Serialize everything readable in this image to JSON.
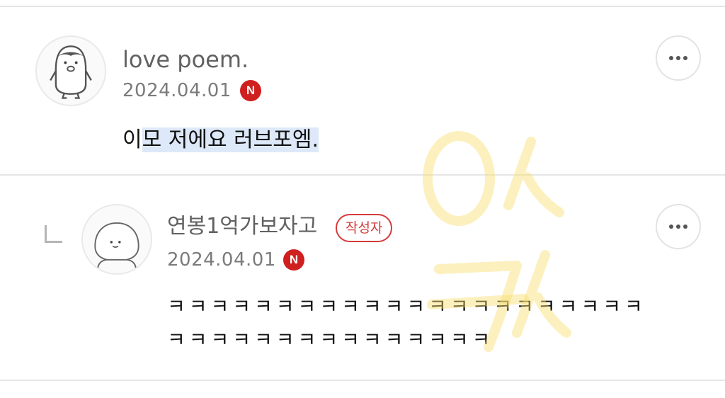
{
  "comments": [
    {
      "author": "love poem.",
      "date": "2024.04.01",
      "badge": "N",
      "text_plain": "이",
      "text_highlighted": "모 저에요 러브포엠.",
      "avatar_icon": "penguin-avatar-icon",
      "menu_icon": "more-options-icon"
    },
    {
      "author": "연봉1억가보자고",
      "author_badge": "작성자",
      "date": "2024.04.01",
      "badge": "N",
      "text_line1": "ㅋㅋㅋㅋㅋㅋㅋㅋㅋㅋㅋㅋㅋㅋㅋㅋㅋㅋㅋㅋㅋㅋ",
      "text_line2": "ㅋㅋㅋㅋㅋㅋㅋㅋㅋㅋㅋㅋㅋㅋㅋ",
      "is_reply": true,
      "avatar_icon": "seal-avatar-icon",
      "menu_icon": "more-options-icon"
    }
  ],
  "colors": {
    "badge_red": "#cf1f1f",
    "author_badge_red": "#d63a3a",
    "highlight_blue": "#dde9f8",
    "watermark_yellow": "#f8dd6e"
  }
}
